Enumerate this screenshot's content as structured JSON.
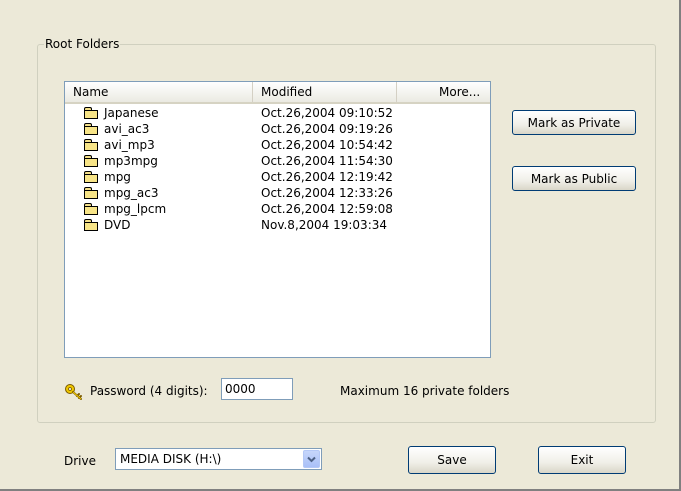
{
  "root_folders": {
    "legend": "Root Folders",
    "columns": [
      "Name",
      "Modified",
      "More..."
    ],
    "rows": [
      {
        "name": "Japanese",
        "modified": "Oct.26,2004 09:10:52",
        "icon": "folder-icon"
      },
      {
        "name": "avi_ac3",
        "modified": "Oct.26,2004 09:19:26",
        "icon": "folder-icon"
      },
      {
        "name": "avi_mp3",
        "modified": "Oct.26,2004 10:54:42",
        "icon": "folder-icon"
      },
      {
        "name": "mp3mpg",
        "modified": "Oct.26,2004 11:54:30",
        "icon": "folder-icon"
      },
      {
        "name": "mpg",
        "modified": "Oct.26,2004 12:19:42",
        "icon": "folder-icon"
      },
      {
        "name": "mpg_ac3",
        "modified": "Oct.26,2004 12:33:26",
        "icon": "folder-icon"
      },
      {
        "name": "mpg_lpcm",
        "modified": "Oct.26,2004 12:59:08",
        "icon": "folder-icon"
      },
      {
        "name": "DVD",
        "modified": "Nov.8,2004 19:03:34",
        "icon": "folder-icon"
      }
    ],
    "mark_private_label": "Mark as Private",
    "mark_public_label": "Mark as Public",
    "password_label": "Password (4 digits):",
    "password_value": "0000",
    "password_icon": "key-icon",
    "max_note": "Maximum 16 private folders"
  },
  "bottom": {
    "drive_label": "Drive",
    "drive_value": "MEDIA DISK (H:\\)",
    "save_label": "Save",
    "exit_label": "Exit"
  },
  "colors": {
    "window_bg": "#ECE9D8",
    "button_border": "#003C74",
    "input_border": "#7F9DB9",
    "combo_button": "#A9C0F7"
  }
}
